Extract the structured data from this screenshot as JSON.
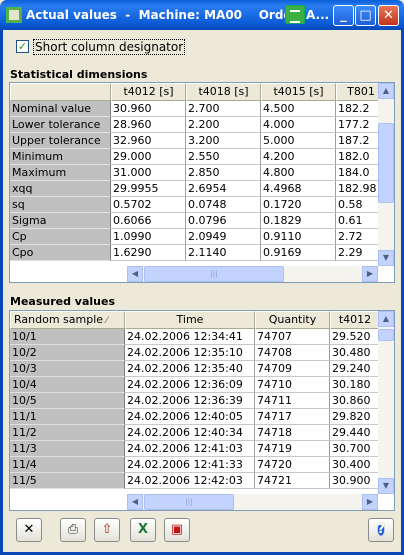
{
  "window": {
    "title": "Actual values  -  Machine: MA00    Order:",
    "title_suffix": "A..."
  },
  "options": {
    "short_designator_label": "Short column designator",
    "short_designator_checked": true
  },
  "stats": {
    "title": "Statistical dimensions",
    "columns": [
      "t4012 [s]",
      "t4018 [s]",
      "t4015 [s]",
      "T801"
    ],
    "rows": [
      {
        "label": "Nominal value",
        "values": [
          "30.960",
          "2.700",
          "4.500",
          "182.2"
        ]
      },
      {
        "label": "Lower tolerance",
        "values": [
          "28.960",
          "2.200",
          "4.000",
          "177.2"
        ]
      },
      {
        "label": "Upper tolerance",
        "values": [
          "32.960",
          "3.200",
          "5.000",
          "187.2"
        ]
      },
      {
        "label": "Minimum",
        "values": [
          "29.000",
          "2.550",
          "4.200",
          "182.0"
        ]
      },
      {
        "label": "Maximum",
        "values": [
          "31.000",
          "2.850",
          "4.800",
          "184.0"
        ]
      },
      {
        "label": "xqq",
        "values": [
          "29.9955",
          "2.6954",
          "4.4968",
          "182.98"
        ]
      },
      {
        "label": "sq",
        "values": [
          "0.5702",
          "0.0748",
          "0.1720",
          "0.58"
        ]
      },
      {
        "label": "Sigma",
        "values": [
          "0.6066",
          "0.0796",
          "0.1829",
          "0.61"
        ]
      },
      {
        "label": "Cp",
        "values": [
          "1.0990",
          "2.0949",
          "0.9110",
          "2.72"
        ]
      },
      {
        "label": "Cpo",
        "values": [
          "1.6290",
          "2.1140",
          "0.9169",
          "2.29"
        ]
      }
    ]
  },
  "measured": {
    "title": "Measured values",
    "row_header": "Random sample",
    "columns": [
      "Time",
      "Quantity",
      "t4012"
    ],
    "rows": [
      {
        "label": "10/1",
        "values": [
          "24.02.2006 12:34:41",
          "74707",
          "29.520"
        ]
      },
      {
        "label": "10/2",
        "values": [
          "24.02.2006 12:35:10",
          "74708",
          "30.480"
        ]
      },
      {
        "label": "10/3",
        "values": [
          "24.02.2006 12:35:40",
          "74709",
          "29.240"
        ]
      },
      {
        "label": "10/4",
        "values": [
          "24.02.2006 12:36:09",
          "74710",
          "30.180"
        ]
      },
      {
        "label": "10/5",
        "values": [
          "24.02.2006 12:36:39",
          "74711",
          "30.860"
        ]
      },
      {
        "label": "11/1",
        "values": [
          "24.02.2006 12:40:05",
          "74717",
          "29.820"
        ]
      },
      {
        "label": "11/2",
        "values": [
          "24.02.2006 12:40:34",
          "74718",
          "29.440"
        ]
      },
      {
        "label": "11/3",
        "values": [
          "24.02.2006 12:41:03",
          "74719",
          "30.700"
        ]
      },
      {
        "label": "11/4",
        "values": [
          "24.02.2006 12:41:33",
          "74720",
          "30.400"
        ]
      },
      {
        "label": "11/5",
        "values": [
          "24.02.2006 12:42:03",
          "74721",
          "30.900"
        ]
      }
    ]
  },
  "toolbar": {
    "buttons": [
      {
        "name": "delete-button",
        "icon": "x-icon",
        "glyph": "✕"
      },
      {
        "name": "print-button",
        "icon": "printer-icon",
        "glyph": "⎙"
      },
      {
        "name": "export-button",
        "icon": "export-icon",
        "glyph": "⇧"
      },
      {
        "name": "excel-button",
        "icon": "excel-icon",
        "glyph": "X"
      },
      {
        "name": "save-button",
        "icon": "disk-icon",
        "glyph": "▣"
      },
      {
        "name": "help-button",
        "icon": "help-icon",
        "glyph": "?"
      }
    ]
  },
  "colors": {
    "title_bar": "#0a5fd8",
    "row_header": "#c0c0c0",
    "excel_green": "#1d7a3a",
    "save_red": "#c0131a",
    "help_blue": "#1f5fd8"
  }
}
